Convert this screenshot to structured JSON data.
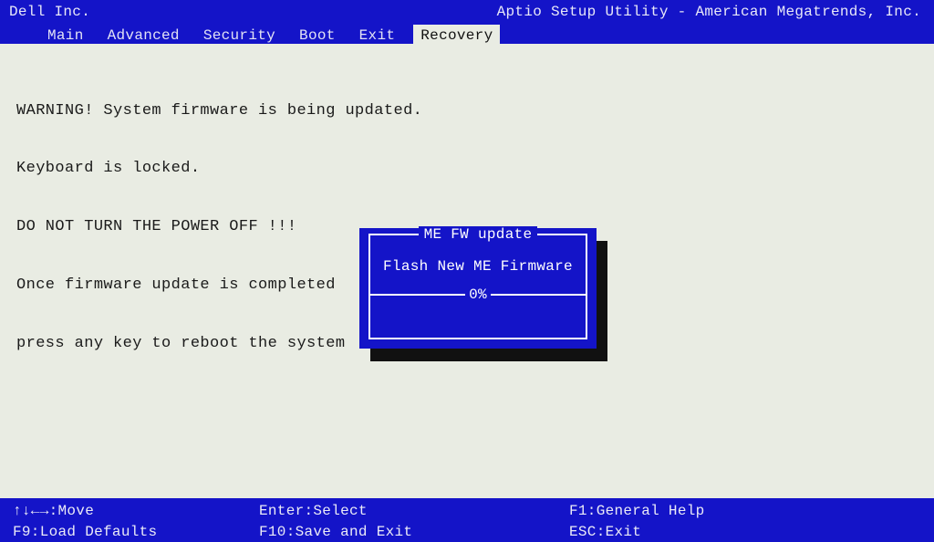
{
  "header": {
    "vendor": "Dell Inc.",
    "utility": "Aptio Setup Utility - American Megatrends, Inc.",
    "tabs": [
      "Main",
      "Advanced",
      "Security",
      "Boot",
      "Exit",
      "Recovery"
    ],
    "active_tab_index": 5
  },
  "warning_lines": [
    "WARNING! System firmware is being updated.",
    "Keyboard is locked.",
    "DO NOT TURN THE POWER OFF !!!",
    "Once firmware update is completed",
    "press any key to reboot the system"
  ],
  "dialog": {
    "title": "ME FW update",
    "message": "Flash New ME Firmware",
    "progress_label": "0%"
  },
  "footer": {
    "col1_row1": "↑↓←→:Move",
    "col1_row2": "F9:Load Defaults",
    "col2_row1": "Enter:Select",
    "col2_row2": "F10:Save and Exit",
    "col3_row1": "F1:General Help",
    "col3_row2": "ESC:Exit"
  }
}
